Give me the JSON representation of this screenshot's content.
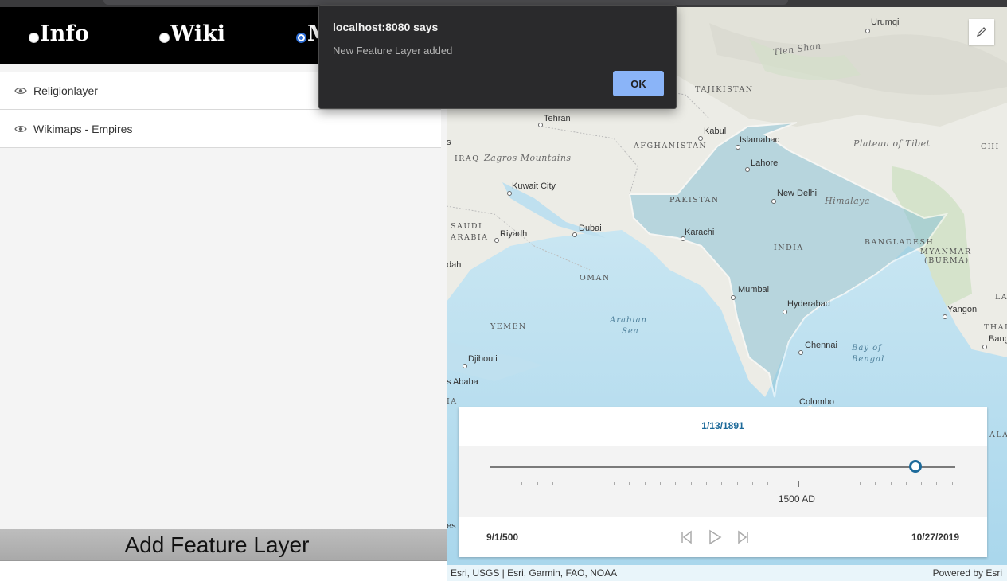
{
  "nav": {
    "items": [
      {
        "label": "Info",
        "selected": false
      },
      {
        "label": "Wiki",
        "selected": false
      },
      {
        "label": "M",
        "selected": true
      }
    ]
  },
  "layers": [
    {
      "label": "Religionlayer",
      "icon": "eye-icon"
    },
    {
      "label": "Wikimaps - Empires",
      "icon": "eye-icon"
    }
  ],
  "add_button_label": "Add Feature Layer",
  "dialog": {
    "title": "localhost:8080 says",
    "message": "New Feature Layer added",
    "ok_label": "OK",
    "ok_color": "#8ab4f8"
  },
  "map": {
    "labels": {
      "urumqi": "Urumqi",
      "tien_shan": "Tien Shan",
      "tajikistan": "TAJIKISTAN",
      "tehran": "Tehran",
      "kabul": "Kabul",
      "afghanistan": "AFGHANISTAN",
      "islamabad": "Islamabad",
      "plateau_tibet": "Plateau of Tibet",
      "chi": "CHI",
      "iraq": "IRAQ",
      "zagros": "Zagros Mountains",
      "lahore": "Lahore",
      "kuwait": "Kuwait City",
      "new_delhi": "New Delhi",
      "himalaya": "Himalaya",
      "pakistan": "PAKISTAN",
      "saudi": "SAUDI",
      "arabia": "ARABIA",
      "riyadh": "Riyadh",
      "dubai": "Dubai",
      "karachi": "Karachi",
      "bangladesh": "BANGLADESH",
      "myanmar1": "MYANMAR",
      "myanmar2": "(BURMA)",
      "india": "INDIA",
      "dah": "dah",
      "oman": "OMAN",
      "mumbai": "Mumbai",
      "la": "LA",
      "hyderabad": "Hyderabad",
      "yangon": "Yangon",
      "arabian_sea1": "Arabian",
      "arabian_sea2": "Sea",
      "yemen": "YEMEN",
      "thaila": "THAILA",
      "chennai": "Chennai",
      "bay1": "Bay of",
      "bay2": "Bengal",
      "bang": "Bang",
      "djibouti": "Djibouti",
      "s_ababa": "s Ababa",
      "ia": "IA",
      "colombo": "Colombo",
      "alay": "ALAY",
      "es": "es",
      "s": "s"
    },
    "edit_icon": "pencil-icon",
    "attribution_left": "Esri, USGS | Esri, Garmin, FAO, NOAA",
    "attribution_right": "Powered by Esri",
    "highlight_color": "#8cc4d6"
  },
  "timeslider": {
    "current_date": "1/13/1891",
    "min_date": "9/1/500",
    "max_date": "10/27/2019",
    "mid_label": "1500 AD",
    "position_fraction": 0.915,
    "mid_label_fraction": 0.659,
    "accent_color": "#1d6a9a"
  }
}
